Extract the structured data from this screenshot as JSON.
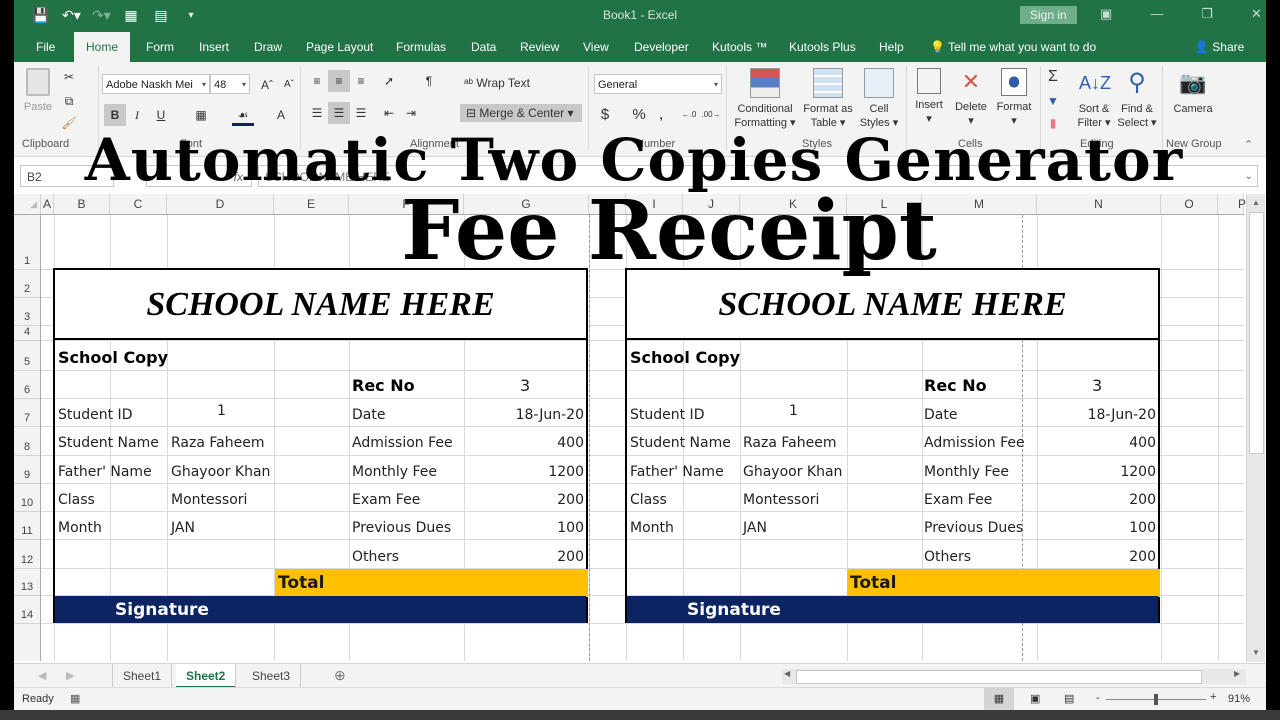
{
  "window": {
    "doc_title": "Book1  -  Excel",
    "sign_in": "Sign in",
    "qat_icons": [
      "save-icon",
      "undo-icon",
      "redo-icon",
      "form-icon",
      "table-icon",
      "customize-icon"
    ]
  },
  "tabs": [
    {
      "label": "File",
      "active": false
    },
    {
      "label": "Home",
      "active": true
    },
    {
      "label": "Form",
      "active": false
    },
    {
      "label": "Insert",
      "active": false
    },
    {
      "label": "Draw",
      "active": false
    },
    {
      "label": "Page Layout",
      "active": false
    },
    {
      "label": "Formulas",
      "active": false
    },
    {
      "label": "Data",
      "active": false
    },
    {
      "label": "Review",
      "active": false
    },
    {
      "label": "View",
      "active": false
    },
    {
      "label": "Developer",
      "active": false
    },
    {
      "label": "Kutools ™",
      "active": false
    },
    {
      "label": "Kutools Plus",
      "active": false
    },
    {
      "label": "Help",
      "active": false
    }
  ],
  "tell_me": "Tell me what you want to do",
  "share": "Share",
  "ribbon": {
    "clipboard": {
      "paste": "Paste",
      "label": "Clipboard"
    },
    "font": {
      "name": "Adobe Naskh Mei",
      "size": "48",
      "label": "Font",
      "bold": "B",
      "italic": "I",
      "underline": "U",
      "font_color": "A"
    },
    "alignment": {
      "wrap_text": "Wrap Text",
      "merge_center": "Merge & Center",
      "label": "Alignment"
    },
    "number": {
      "format": "General",
      "currency": "$",
      "percent": "%",
      "comma": ",",
      "label": "Number"
    },
    "styles": {
      "conditional": "Conditional",
      "conditional2": "Formatting",
      "format_as": "Format as",
      "format_as2": "Table",
      "cell": "Cell",
      "cell2": "Styles",
      "label": "Styles"
    },
    "cells": {
      "insert": "Insert",
      "delete": "Delete",
      "format": "Format",
      "label": "Cells"
    },
    "editing": {
      "sort": "Sort &",
      "sort2": "Filter",
      "find": "Find &",
      "find2": "Select",
      "label": "Editing"
    },
    "new_group": {
      "camera": "Camera",
      "label": "New Group"
    }
  },
  "formula_bar": {
    "name_box": "B2",
    "fx": "fx",
    "content": "SCHOOL NAME HERE"
  },
  "columns": [
    "A",
    "B",
    "C",
    "D",
    "E",
    "F",
    "G",
    "H",
    "I",
    "J",
    "K",
    "L",
    "M",
    "N",
    "O",
    "P"
  ],
  "rows": [
    "1",
    "2",
    "3",
    "4",
    "5",
    "6",
    "7",
    "8",
    "9",
    "10",
    "11",
    "12",
    "13",
    "14"
  ],
  "overlay_titles": {
    "line1": "Automatic Two Copies Generator",
    "line2": "Fee Receipt"
  },
  "receipts": [
    {
      "school_name": "SCHOOL NAME HERE",
      "copy_label": "School Copy",
      "rec_no_label": "Rec No",
      "rec_no": "3",
      "left_fields": [
        {
          "label": "Student ID",
          "value": "1"
        },
        {
          "label": "Student Name",
          "value": "Raza Faheem"
        },
        {
          "label": "Father' Name",
          "value": "Ghayoor Khan"
        },
        {
          "label": "Class",
          "value": "Montessori"
        },
        {
          "label": "Month",
          "value": "JAN"
        }
      ],
      "right_fields": [
        {
          "label": "Date",
          "value": "18-Jun-20"
        },
        {
          "label": "Admission Fee",
          "value": "400"
        },
        {
          "label": "Monthly Fee",
          "value": "1200"
        },
        {
          "label": "Exam Fee",
          "value": "200"
        },
        {
          "label": "Previous Dues",
          "value": "100"
        },
        {
          "label": "Others",
          "value": "200"
        }
      ],
      "total_label": "Total",
      "signature_label": "Signature"
    },
    {
      "school_name": "SCHOOL NAME HERE",
      "copy_label": "School Copy",
      "rec_no_label": "Rec No",
      "rec_no": "3",
      "left_fields": [
        {
          "label": "Student ID",
          "value": "1"
        },
        {
          "label": "Student Name",
          "value": "Raza Faheem"
        },
        {
          "label": "Father' Name",
          "value": "Ghayoor Khan"
        },
        {
          "label": "Class",
          "value": "Montessori"
        },
        {
          "label": "Month",
          "value": "JAN"
        }
      ],
      "right_fields": [
        {
          "label": "Date",
          "value": "18-Jun-20"
        },
        {
          "label": "Admission Fee",
          "value": "400"
        },
        {
          "label": "Monthly Fee",
          "value": "1200"
        },
        {
          "label": "Exam Fee",
          "value": "200"
        },
        {
          "label": "Previous Dues",
          "value": "100"
        },
        {
          "label": "Others",
          "value": "200"
        }
      ],
      "total_label": "Total",
      "signature_label": "Signature"
    }
  ],
  "sheets": [
    {
      "label": "Sheet1",
      "active": false
    },
    {
      "label": "Sheet2",
      "active": true
    },
    {
      "label": "Sheet3",
      "active": false
    }
  ],
  "status": {
    "ready": "Ready",
    "zoom": "91%",
    "zoom_minus": "-",
    "zoom_plus": "+"
  },
  "colors": {
    "excel_green": "#217346",
    "total_fill": "#FFC000",
    "signature_fill": "#0C2461"
  }
}
